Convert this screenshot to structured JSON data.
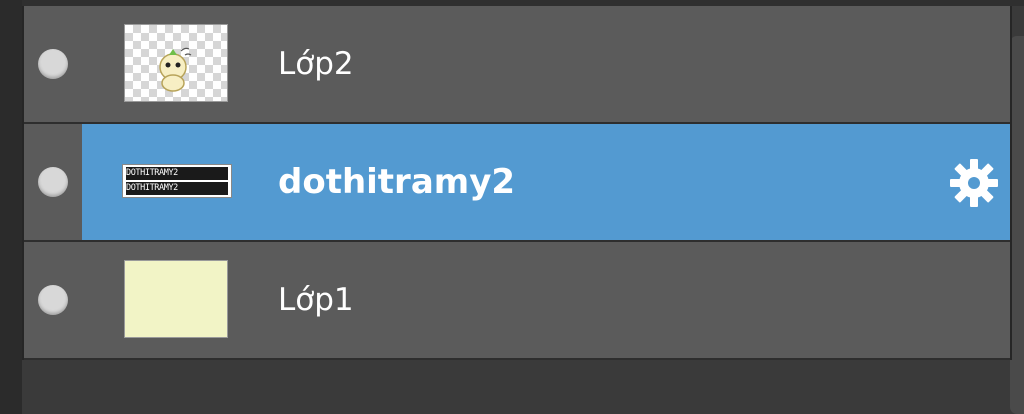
{
  "layers": [
    {
      "name": "Lớp2",
      "selected": false,
      "thumbnail": "character-sticker-icon"
    },
    {
      "name": "dothitramy2",
      "selected": true,
      "thumbnail": "text",
      "thumbnail_lines": [
        "DOTHITRAMY2",
        "DOTHITRAMY2"
      ],
      "settings_icon": "gear-icon"
    },
    {
      "name": "Lớp1",
      "selected": false,
      "thumbnail": "solid-fill",
      "thumbnail_color": "#f2f4c6"
    }
  ],
  "colors": {
    "row_bg": "#5b5b5b",
    "selected_bg": "#539ad1",
    "panel_bg": "#3a3a3a",
    "text": "#ffffff"
  }
}
